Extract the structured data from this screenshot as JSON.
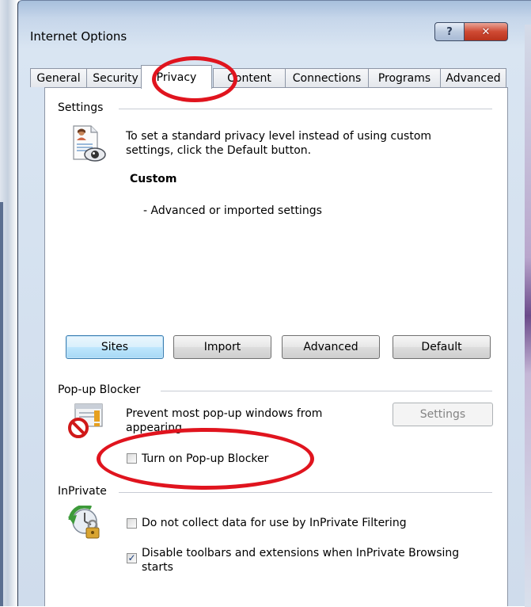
{
  "window": {
    "title": "Internet Options",
    "help_glyph": "?",
    "close_glyph": "✕"
  },
  "tabs": [
    {
      "label": "General"
    },
    {
      "label": "Security"
    },
    {
      "label": "Privacy",
      "active": true
    },
    {
      "label": "Content"
    },
    {
      "label": "Connections"
    },
    {
      "label": "Programs"
    },
    {
      "label": "Advanced"
    }
  ],
  "settings": {
    "group_label": "Settings",
    "description": "To set a standard privacy level instead of using custom settings, click the Default button.",
    "level_name": "Custom",
    "level_detail": "- Advanced or imported settings",
    "buttons": {
      "sites": "Sites",
      "import": "Import",
      "advanced": "Advanced",
      "default": "Default"
    }
  },
  "popup_blocker": {
    "group_label": "Pop-up Blocker",
    "description": "Prevent most pop-up windows from appearing.",
    "settings_button": "Settings",
    "checkbox_label": "Turn on Pop-up Blocker",
    "checked": false
  },
  "inprivate": {
    "group_label": "InPrivate",
    "option1_label": "Do not collect data for use by InPrivate Filtering",
    "option1_checked": false,
    "option2_label": "Disable toolbars and extensions when InPrivate Browsing starts",
    "option2_checked": true,
    "check_glyph": "✓"
  },
  "colors": {
    "annotation": "#e0141e",
    "accent": "#3c7fb1"
  },
  "icons": [
    "privacy-document-eye-icon",
    "popup-blocked-icon",
    "inprivate-lock-icon"
  ]
}
